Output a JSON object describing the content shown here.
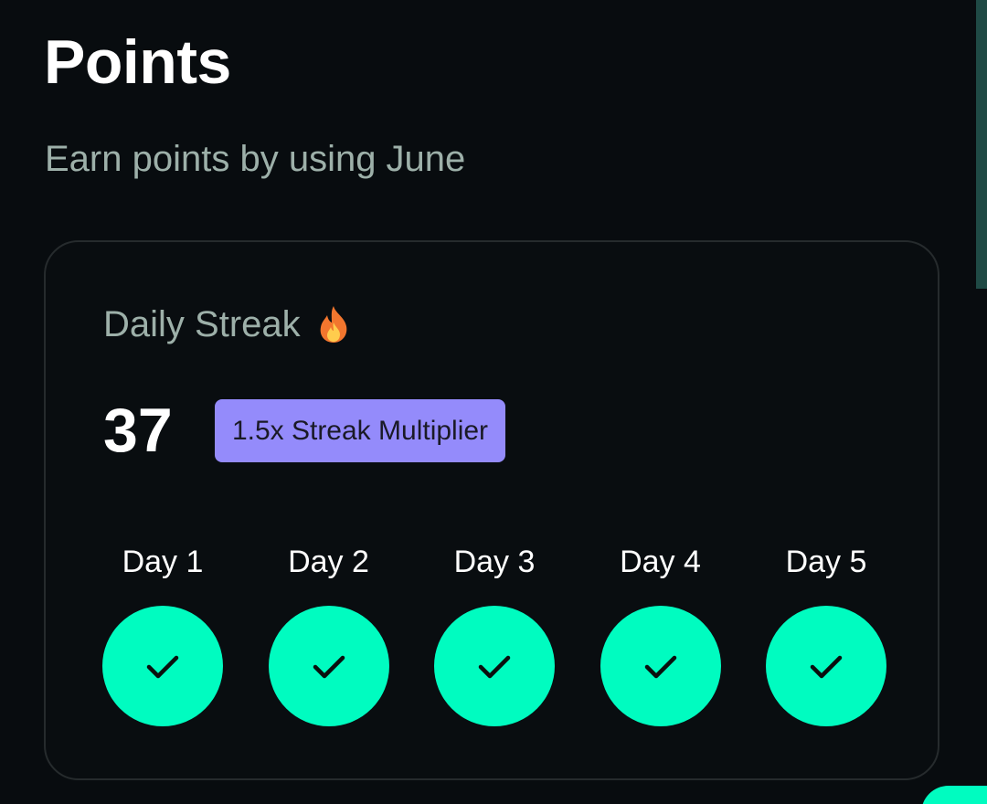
{
  "header": {
    "title": "Points",
    "subtitle": "Earn points by using June"
  },
  "streak_card": {
    "heading": "Daily Streak",
    "heading_icon": "fire-icon",
    "count": "37",
    "multiplier_label": "1.5x Streak Multiplier",
    "days": [
      {
        "label": "Day 1",
        "completed": true,
        "icon": "check-icon"
      },
      {
        "label": "Day 2",
        "completed": true,
        "icon": "check-icon"
      },
      {
        "label": "Day 3",
        "completed": true,
        "icon": "check-icon"
      },
      {
        "label": "Day 4",
        "completed": true,
        "icon": "check-icon"
      },
      {
        "label": "Day 5",
        "completed": true,
        "icon": "check-icon"
      }
    ]
  },
  "colors": {
    "background": "#080c0f",
    "card_border": "#262b2d",
    "muted_text": "#9db0a9",
    "accent": "#00fcc0",
    "badge": "#948bfb"
  }
}
